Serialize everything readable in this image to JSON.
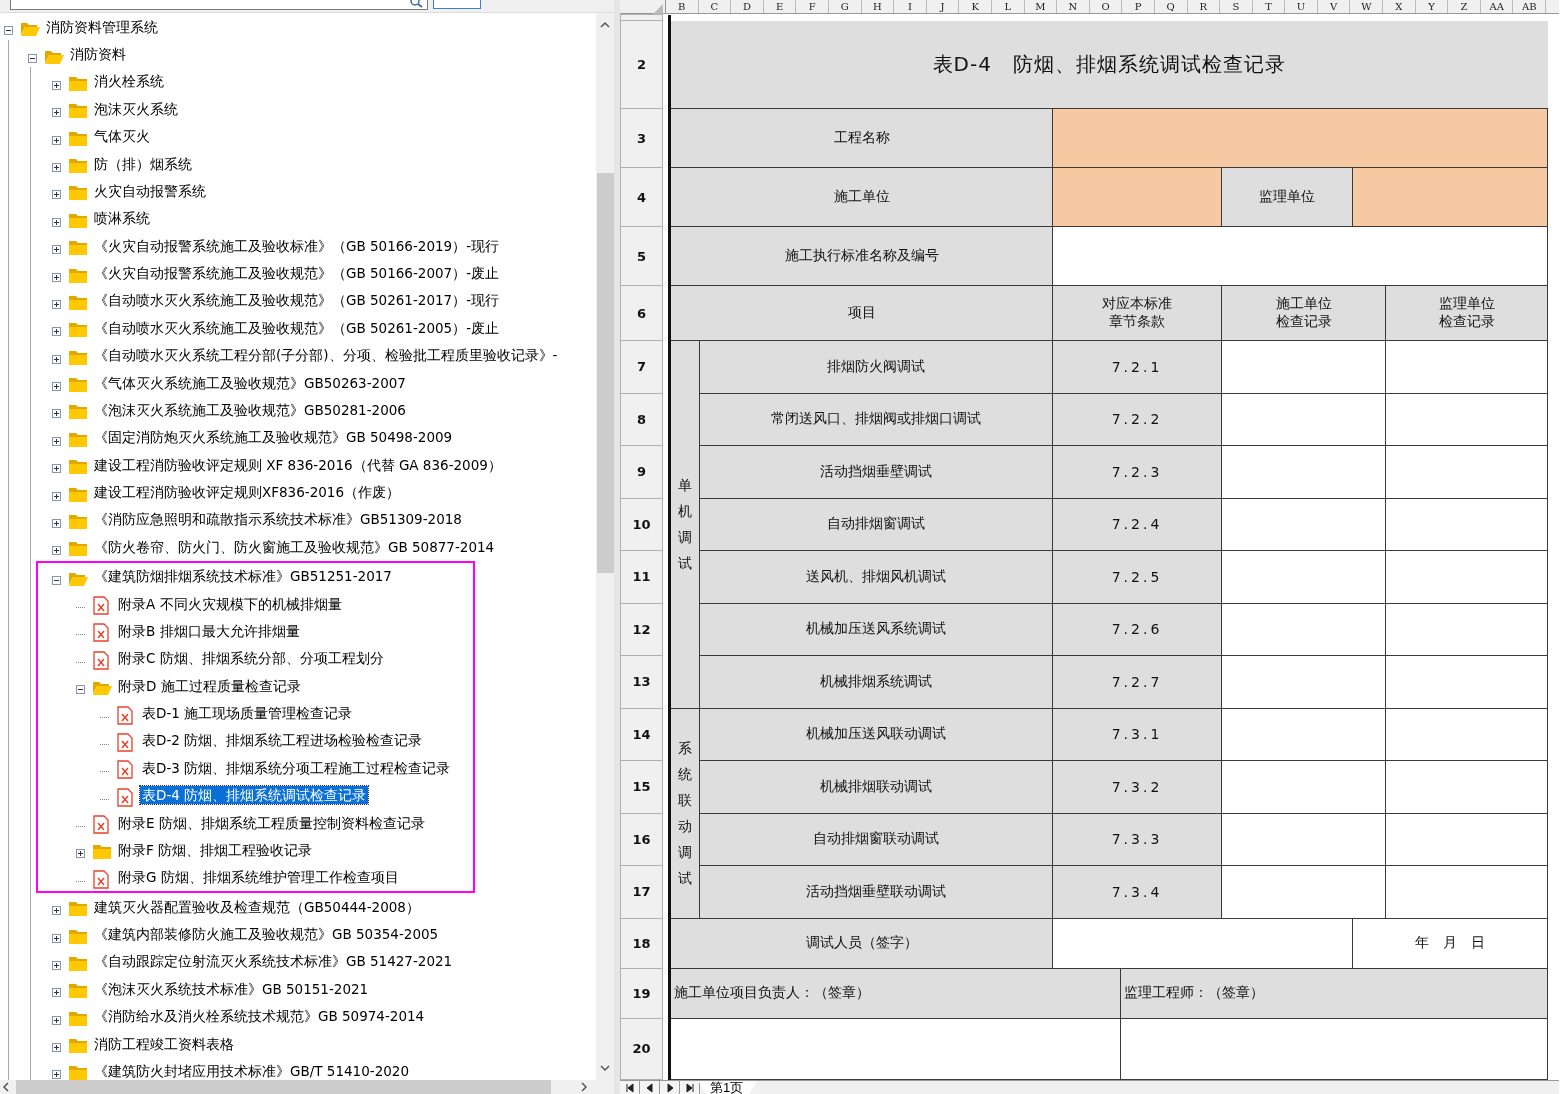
{
  "tree": [
    {
      "label": "消防资料管理系统",
      "kind": "folder",
      "expanded": true,
      "selected": false,
      "children": [
        {
          "label": "消防资料",
          "kind": "folder",
          "expanded": true,
          "selected": false,
          "children": [
            {
              "label": "消火栓系统",
              "kind": "folder",
              "expanded": false,
              "selected": false
            },
            {
              "label": "泡沫灭火系统",
              "kind": "folder",
              "expanded": false,
              "selected": false
            },
            {
              "label": "气体灭火",
              "kind": "folder",
              "expanded": false,
              "selected": false
            },
            {
              "label": "防（排）烟系统",
              "kind": "folder",
              "expanded": false,
              "selected": false
            },
            {
              "label": "火灾自动报警系统",
              "kind": "folder",
              "expanded": false,
              "selected": false
            },
            {
              "label": "喷淋系统",
              "kind": "folder",
              "expanded": false,
              "selected": false
            },
            {
              "label": "《火灾自动报警系统施工及验收标准》（GB 50166-2019）-现行",
              "kind": "folder",
              "expanded": false,
              "selected": false
            },
            {
              "label": "《火灾自动报警系统施工及验收规范》（GB 50166-2007）-废止",
              "kind": "folder",
              "expanded": false,
              "selected": false
            },
            {
              "label": "《自动喷水灭火系统施工及验收规范》（GB 50261-2017）-现行",
              "kind": "folder",
              "expanded": false,
              "selected": false
            },
            {
              "label": "《自动喷水灭火系统施工及验收规范》（GB 50261-2005）-废止",
              "kind": "folder",
              "expanded": false,
              "selected": false
            },
            {
              "label": "《自动喷水灭火系统工程分部(子分部)、分项、检验批工程质里验收记录》-",
              "kind": "folder",
              "expanded": false,
              "selected": false
            },
            {
              "label": "《气体灭火系统施工及验收规范》GB50263-2007",
              "kind": "folder",
              "expanded": false,
              "selected": false
            },
            {
              "label": "《泡沫灭火系统施工及验收规范》GB50281-2006",
              "kind": "folder",
              "expanded": false,
              "selected": false
            },
            {
              "label": "《固定消防炮灭火系统施工及验收规范》GB 50498-2009",
              "kind": "folder",
              "expanded": false,
              "selected": false
            },
            {
              "label": "建设工程消防验收评定规则 XF 836-2016（代替 GA 836-2009）",
              "kind": "folder",
              "expanded": false,
              "selected": false
            },
            {
              "label": "建设工程消防验收评定规则XF836-2016（作废）",
              "kind": "folder",
              "expanded": false,
              "selected": false
            },
            {
              "label": "《消防应急照明和疏散指示系统技术标准》GB51309-2018",
              "kind": "folder",
              "expanded": false,
              "selected": false
            },
            {
              "label": "《防火卷帘、防火门、防火窗施工及验收规范》GB 50877-2014",
              "kind": "folder",
              "expanded": false,
              "selected": false
            },
            {
              "label": "《建筑防烟排烟系统技术标准》GB51251-2017",
              "kind": "folder",
              "expanded": true,
              "selected": false,
              "outlined": true,
              "children": [
                {
                  "label": "附录A 不同火灾规模下的机械排烟量",
                  "kind": "file",
                  "selected": false
                },
                {
                  "label": "附录B 排烟口最大允许排烟量",
                  "kind": "file",
                  "selected": false
                },
                {
                  "label": "附录C 防烟、排烟系统分部、分项工程划分",
                  "kind": "file",
                  "selected": false
                },
                {
                  "label": "附录D 施工过程质量检查记录",
                  "kind": "folder",
                  "expanded": true,
                  "selected": false,
                  "children": [
                    {
                      "label": "表D-1 施工现场质量管理检查记录",
                      "kind": "file",
                      "selected": false
                    },
                    {
                      "label": "表D-2 防烟、排烟系统工程进场检验检查记录",
                      "kind": "file",
                      "selected": false
                    },
                    {
                      "label": "表D-3 防烟、排烟系统分项工程施工过程检查记录",
                      "kind": "file",
                      "selected": false
                    },
                    {
                      "label": "表D-4 防烟、排烟系统调试检查记录",
                      "kind": "file",
                      "selected": true
                    }
                  ]
                },
                {
                  "label": "附录E 防烟、排烟系统工程质量控制资料检查记录",
                  "kind": "file",
                  "selected": false
                },
                {
                  "label": "附录F 防烟、排烟工程验收记录",
                  "kind": "folder",
                  "expanded": false,
                  "selected": false
                },
                {
                  "label": "附录G 防烟、排烟系统维护管理工作检查项目",
                  "kind": "file",
                  "selected": false
                }
              ]
            },
            {
              "label": "建筑灭火器配置验收及检查规范（GB50444-2008）",
              "kind": "folder",
              "expanded": false,
              "selected": false
            },
            {
              "label": "《建筑内部装修防火施工及验收规范》GB 50354-2005",
              "kind": "folder",
              "expanded": false,
              "selected": false
            },
            {
              "label": "《自动跟踪定位射流灭火系统技术标准》GB 51427-2021",
              "kind": "folder",
              "expanded": false,
              "selected": false
            },
            {
              "label": "《泡沫灭火系统技术标准》GB 50151-2021",
              "kind": "folder",
              "expanded": false,
              "selected": false
            },
            {
              "label": "《消防给水及消火栓系统技术规范》GB 50974-2014",
              "kind": "folder",
              "expanded": false,
              "selected": false
            },
            {
              "label": "消防工程竣工资料表格",
              "kind": "folder",
              "expanded": false,
              "selected": false
            },
            {
              "label": "《建筑防火封堵应用技术标准》GB/T 51410-2020",
              "kind": "folder",
              "expanded": false,
              "selected": false
            }
          ]
        }
      ]
    }
  ],
  "sheet": {
    "column_letters": [
      "B",
      "C",
      "D",
      "E",
      "F",
      "G",
      "H",
      "I",
      "J",
      "K",
      "L",
      "M",
      "N",
      "O",
      "P",
      "Q",
      "R",
      "S",
      "T",
      "U",
      "V",
      "W",
      "X",
      "Y",
      "Z",
      "AA",
      "AB"
    ],
    "row_numbers": [
      "2",
      "3",
      "4",
      "5",
      "6",
      "7",
      "8",
      "9",
      "10",
      "11",
      "12",
      "13",
      "14",
      "15",
      "16",
      "17",
      "18",
      "19",
      "20"
    ],
    "form": {
      "title": "表D-4　防烟、排烟系统调试检查记录",
      "project_label": "工程名称",
      "contractor_label": "施工单位",
      "supervisor_label": "监理单位",
      "standard_label": "施工执行标准名称及编号",
      "headers": [
        {
          "lines": [
            "项目"
          ]
        },
        {
          "lines": [
            "对应本标准",
            "章节条款"
          ]
        },
        {
          "lines": [
            "施工单位",
            "检查记录"
          ]
        },
        {
          "lines": [
            "监理单位",
            "检查记录"
          ]
        }
      ],
      "groups": [
        {
          "label": "单机调试",
          "items": [
            {
              "name": "排烟防火阀调试",
              "clause": "7.2.1"
            },
            {
              "name": "常闭送风口、排烟阀或排烟口调试",
              "clause": "7.2.2"
            },
            {
              "name": "活动挡烟垂壁调试",
              "clause": "7.2.3"
            },
            {
              "name": "自动排烟窗调试",
              "clause": "7.2.4"
            },
            {
              "name": "送风机、排烟风机调试",
              "clause": "7.2.5"
            },
            {
              "name": "机械加压送风系统调试",
              "clause": "7.2.6"
            },
            {
              "name": "机械排烟系统调试",
              "clause": "7.2.7"
            }
          ]
        },
        {
          "label": "系统联动调试",
          "items": [
            {
              "name": "机械加压送风联动调试",
              "clause": "7.3.1"
            },
            {
              "name": "机械排烟联动调试",
              "clause": "7.3.2"
            },
            {
              "name": "自动排烟窗联动调试",
              "clause": "7.3.3"
            },
            {
              "name": "活动挡烟垂壁联动调试",
              "clause": "7.3.4"
            }
          ]
        }
      ],
      "tester_label": "调试人员（签字）",
      "date_label": "年　月　日",
      "contractor_sign": "施工单位项目负责人：（签章）",
      "supervisor_sign": "监理工程师：（签章）"
    },
    "tabs": [
      {
        "label": "第1页",
        "selected": true
      }
    ]
  }
}
